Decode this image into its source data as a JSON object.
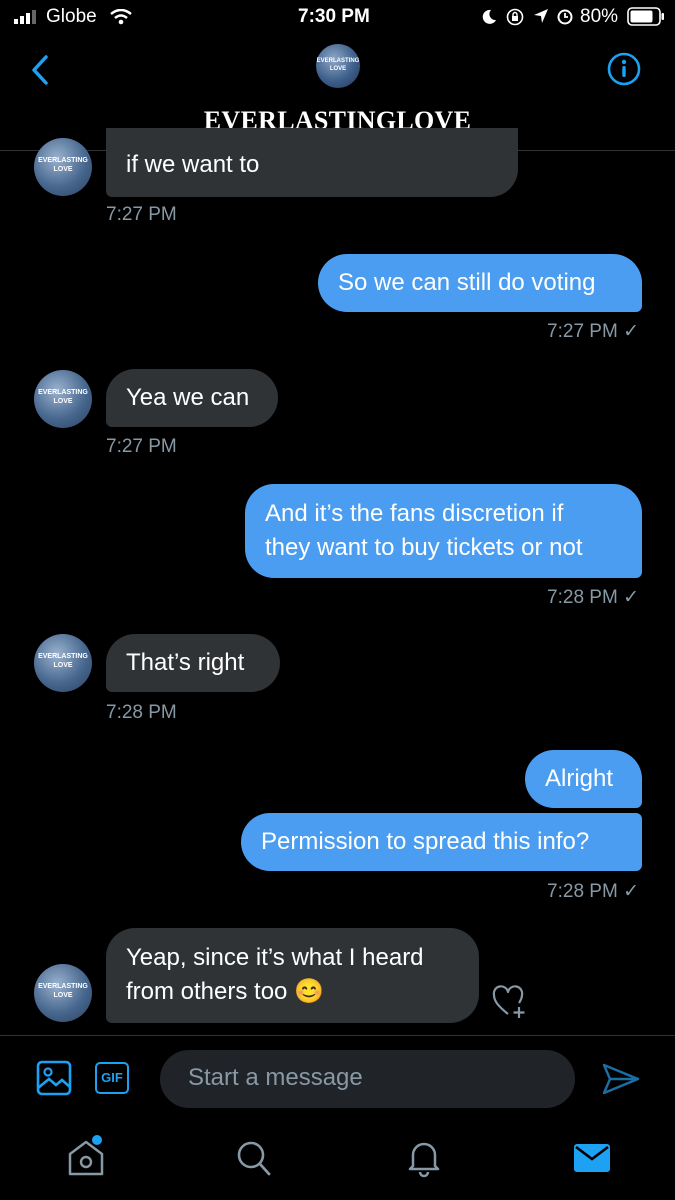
{
  "status_bar": {
    "carrier": "Globe",
    "time": "7:30 PM",
    "battery": "80%"
  },
  "header": {
    "title": "EVERLASTINGLOVE",
    "avatar_text": "EVERLASTING LOVE"
  },
  "messages": [
    {
      "text": "if we want to",
      "time": "7:27 PM",
      "direction": "incoming"
    },
    {
      "text": "So we can still do voting",
      "time": "7:27 PM ✓",
      "direction": "outgoing"
    },
    {
      "text": "Yea we can",
      "time": "7:27 PM",
      "direction": "incoming"
    },
    {
      "text_line1": "And it’s the fans discretion if",
      "text_line2": "they want to buy tickets or not",
      "time": "7:28 PM ✓",
      "direction": "outgoing"
    },
    {
      "text": "That’s right",
      "time": "7:28 PM",
      "direction": "incoming"
    },
    {
      "text": "Alright",
      "direction": "outgoing"
    },
    {
      "text": "Permission to spread this info?",
      "time": "7:28 PM ✓",
      "direction": "outgoing"
    },
    {
      "text_line1": "Yeap, since it’s what I heard",
      "text_line2": "from others too 😊",
      "direction": "incoming"
    }
  ],
  "composer": {
    "placeholder": "Start a message",
    "gif_label": "GIF"
  },
  "colors": {
    "accent": "#1da1f2",
    "outgoing_bubble": "#4a9df0",
    "incoming_bubble": "#2f3336",
    "muted": "#8899a6"
  }
}
